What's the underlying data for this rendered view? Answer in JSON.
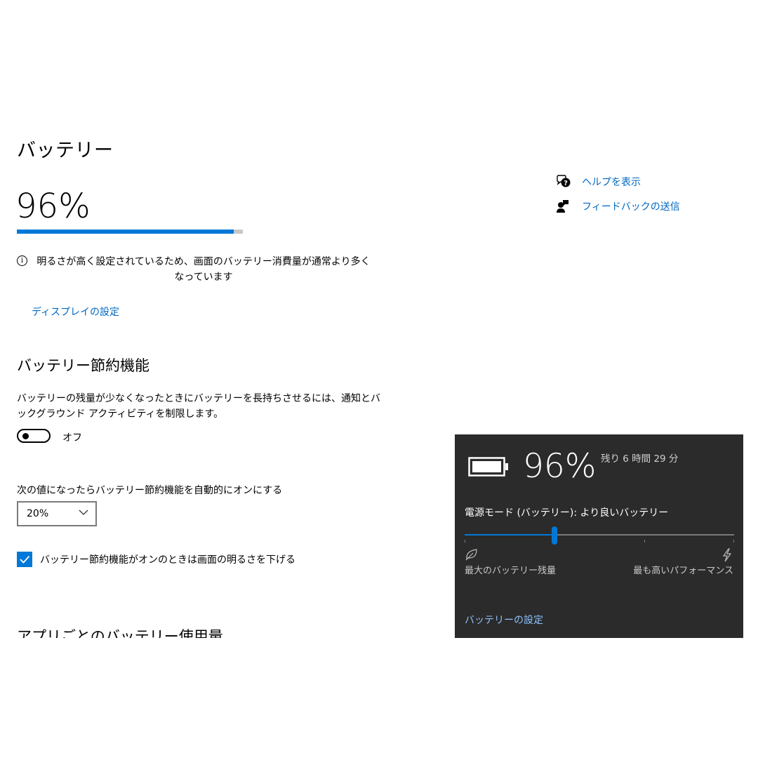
{
  "page": {
    "title": "バッテリー",
    "battery_percent_text": "96%",
    "battery_level_fraction": 0.96
  },
  "info": {
    "icon": "info-icon",
    "text": "明るさが高く設定されているため、画面のバッテリー消費量が通常より多くなっています"
  },
  "display_link": "ディスプレイの設定",
  "saver": {
    "title": "バッテリー節約機能",
    "description": "バッテリーの残量が少なくなったときにバッテリーを長持ちさせるには、通知とバックグラウンド アクティビティを制限します。",
    "toggle_state": "off",
    "toggle_label": "オフ",
    "threshold_label": "次の値になったらバッテリー節約機能を自動的にオンにする",
    "threshold_value": "20%",
    "dim_checkbox_checked": true,
    "dim_checkbox_label": "バッテリー節約機能がオンのときは画面の明るさを下げる"
  },
  "per_app_heading": "アプリごとのバッテリー使用量",
  "right_links": {
    "help": {
      "icon": "help-chat-icon",
      "label": "ヘルプを表示"
    },
    "feedback": {
      "icon": "feedback-person-icon",
      "label": "フィードバックの送信"
    }
  },
  "flyout": {
    "battery_icon": "battery-icon",
    "percent_text": "96%",
    "remaining": "残り 6 時間 29 分",
    "power_mode_label": "電源モード (バッテリー): より良いバッテリー",
    "slider_value_fraction": 0.333,
    "left_icon": "leaf-icon",
    "right_icon": "lightning-icon",
    "left_label": "最大のバッテリー残量",
    "right_label": "最も高いパフォーマンス",
    "settings_link": "バッテリーの設定"
  },
  "colors": {
    "accent": "#0078d7",
    "link": "#0067c0",
    "flyout_bg": "#2b2b2b",
    "flyout_link": "#8ec3ff"
  }
}
